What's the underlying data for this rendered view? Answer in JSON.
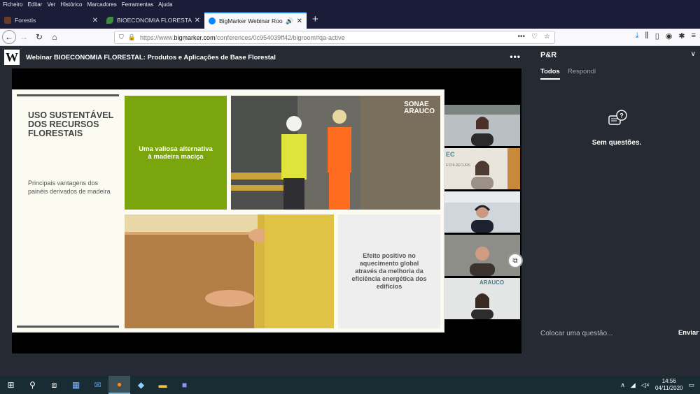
{
  "menu": [
    "Ficheiro",
    "Editar",
    "Ver",
    "Histórico",
    "Marcadores",
    "Ferramentas",
    "Ajuda"
  ],
  "tabs": [
    {
      "title": "Forestis",
      "icon": "forestis-favicon",
      "color": "#6a3b2a",
      "active": false
    },
    {
      "title": "BIOECONOMIA FLORESTAL: Pro",
      "icon": "leaf-favicon",
      "color": "#3c8f3c",
      "active": false
    },
    {
      "title": "BigMarker Webinar Room",
      "icon": "bigmarker-favicon",
      "color": "#0a84ff",
      "active": true
    }
  ],
  "url": {
    "prefix": "https://www.",
    "host": "bigmarker.com",
    "path": "/conferences/0c954039ff42/bigroom#qa-active"
  },
  "webinar": {
    "logo": "W",
    "title": "Webinar BIOECONOMIA FLORESTAL: Produtos e Aplicações de Base Florestal",
    "more": "•••"
  },
  "slide": {
    "title": "USO SUSTENTÁVEL DOS RECURSOS FLORESTAIS",
    "subtitle": "Principais vantagens dos painéis derivados de madeira",
    "green_text": "Uma valiosa alternativa à madeira maciça",
    "gray_text": "Efeito positivo no aquecimento global através da melhoria da eficiência energética dos edifícios",
    "brand_line1": "SONAE",
    "brand_line2": "ARAUCO",
    "accent": "#7aa50c"
  },
  "cams_text": {
    "cam2_a": "EC",
    "cam2_b": "ESTA RECURS",
    "cam5": "ARAUCO"
  },
  "qa": {
    "title": "P&R",
    "tab_all": "Todos",
    "tab_answered": "Respondi",
    "empty": "Sem questões.",
    "placeholder": "Colocar uma questão...",
    "send": "Enviar"
  },
  "clock": {
    "time": "14:56",
    "date": "04/11/2020"
  }
}
